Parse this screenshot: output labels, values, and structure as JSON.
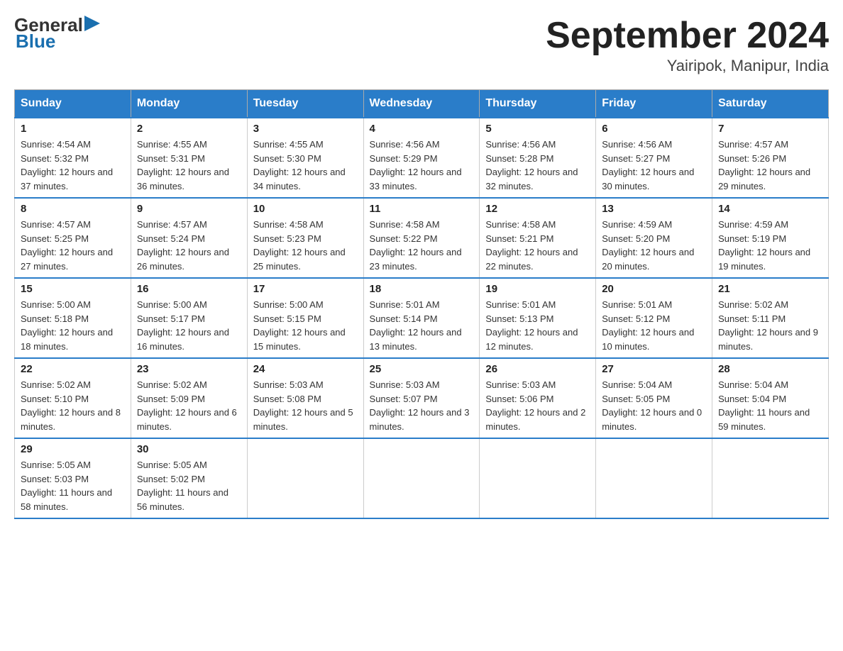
{
  "header": {
    "logo": {
      "general": "General",
      "blue": "Blue"
    },
    "title": "September 2024",
    "subtitle": "Yairipok, Manipur, India"
  },
  "days_of_week": [
    "Sunday",
    "Monday",
    "Tuesday",
    "Wednesday",
    "Thursday",
    "Friday",
    "Saturday"
  ],
  "weeks": [
    [
      {
        "day": "1",
        "sunrise": "4:54 AM",
        "sunset": "5:32 PM",
        "daylight": "12 hours and 37 minutes."
      },
      {
        "day": "2",
        "sunrise": "4:55 AM",
        "sunset": "5:31 PM",
        "daylight": "12 hours and 36 minutes."
      },
      {
        "day": "3",
        "sunrise": "4:55 AM",
        "sunset": "5:30 PM",
        "daylight": "12 hours and 34 minutes."
      },
      {
        "day": "4",
        "sunrise": "4:56 AM",
        "sunset": "5:29 PM",
        "daylight": "12 hours and 33 minutes."
      },
      {
        "day": "5",
        "sunrise": "4:56 AM",
        "sunset": "5:28 PM",
        "daylight": "12 hours and 32 minutes."
      },
      {
        "day": "6",
        "sunrise": "4:56 AM",
        "sunset": "5:27 PM",
        "daylight": "12 hours and 30 minutes."
      },
      {
        "day": "7",
        "sunrise": "4:57 AM",
        "sunset": "5:26 PM",
        "daylight": "12 hours and 29 minutes."
      }
    ],
    [
      {
        "day": "8",
        "sunrise": "4:57 AM",
        "sunset": "5:25 PM",
        "daylight": "12 hours and 27 minutes."
      },
      {
        "day": "9",
        "sunrise": "4:57 AM",
        "sunset": "5:24 PM",
        "daylight": "12 hours and 26 minutes."
      },
      {
        "day": "10",
        "sunrise": "4:58 AM",
        "sunset": "5:23 PM",
        "daylight": "12 hours and 25 minutes."
      },
      {
        "day": "11",
        "sunrise": "4:58 AM",
        "sunset": "5:22 PM",
        "daylight": "12 hours and 23 minutes."
      },
      {
        "day": "12",
        "sunrise": "4:58 AM",
        "sunset": "5:21 PM",
        "daylight": "12 hours and 22 minutes."
      },
      {
        "day": "13",
        "sunrise": "4:59 AM",
        "sunset": "5:20 PM",
        "daylight": "12 hours and 20 minutes."
      },
      {
        "day": "14",
        "sunrise": "4:59 AM",
        "sunset": "5:19 PM",
        "daylight": "12 hours and 19 minutes."
      }
    ],
    [
      {
        "day": "15",
        "sunrise": "5:00 AM",
        "sunset": "5:18 PM",
        "daylight": "12 hours and 18 minutes."
      },
      {
        "day": "16",
        "sunrise": "5:00 AM",
        "sunset": "5:17 PM",
        "daylight": "12 hours and 16 minutes."
      },
      {
        "day": "17",
        "sunrise": "5:00 AM",
        "sunset": "5:15 PM",
        "daylight": "12 hours and 15 minutes."
      },
      {
        "day": "18",
        "sunrise": "5:01 AM",
        "sunset": "5:14 PM",
        "daylight": "12 hours and 13 minutes."
      },
      {
        "day": "19",
        "sunrise": "5:01 AM",
        "sunset": "5:13 PM",
        "daylight": "12 hours and 12 minutes."
      },
      {
        "day": "20",
        "sunrise": "5:01 AM",
        "sunset": "5:12 PM",
        "daylight": "12 hours and 10 minutes."
      },
      {
        "day": "21",
        "sunrise": "5:02 AM",
        "sunset": "5:11 PM",
        "daylight": "12 hours and 9 minutes."
      }
    ],
    [
      {
        "day": "22",
        "sunrise": "5:02 AM",
        "sunset": "5:10 PM",
        "daylight": "12 hours and 8 minutes."
      },
      {
        "day": "23",
        "sunrise": "5:02 AM",
        "sunset": "5:09 PM",
        "daylight": "12 hours and 6 minutes."
      },
      {
        "day": "24",
        "sunrise": "5:03 AM",
        "sunset": "5:08 PM",
        "daylight": "12 hours and 5 minutes."
      },
      {
        "day": "25",
        "sunrise": "5:03 AM",
        "sunset": "5:07 PM",
        "daylight": "12 hours and 3 minutes."
      },
      {
        "day": "26",
        "sunrise": "5:03 AM",
        "sunset": "5:06 PM",
        "daylight": "12 hours and 2 minutes."
      },
      {
        "day": "27",
        "sunrise": "5:04 AM",
        "sunset": "5:05 PM",
        "daylight": "12 hours and 0 minutes."
      },
      {
        "day": "28",
        "sunrise": "5:04 AM",
        "sunset": "5:04 PM",
        "daylight": "11 hours and 59 minutes."
      }
    ],
    [
      {
        "day": "29",
        "sunrise": "5:05 AM",
        "sunset": "5:03 PM",
        "daylight": "11 hours and 58 minutes."
      },
      {
        "day": "30",
        "sunrise": "5:05 AM",
        "sunset": "5:02 PM",
        "daylight": "11 hours and 56 minutes."
      },
      null,
      null,
      null,
      null,
      null
    ]
  ]
}
